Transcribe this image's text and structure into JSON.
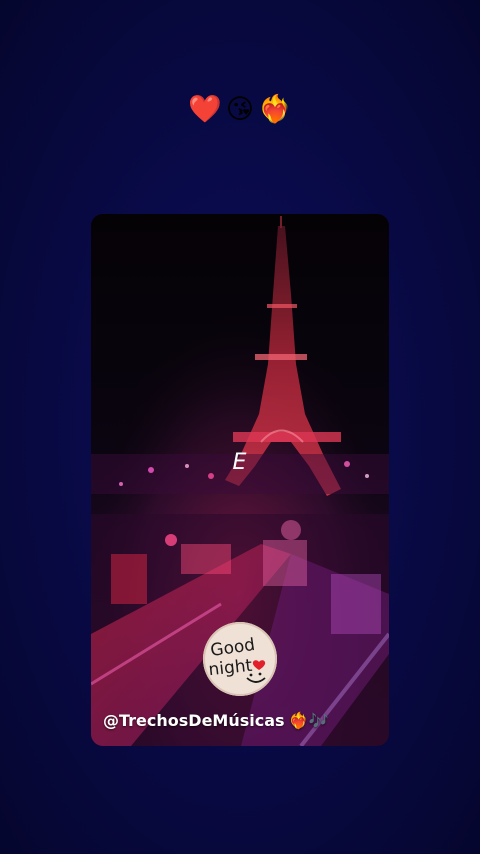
{
  "top_reactions": {
    "emojis": [
      "❤️",
      "😘",
      "❤️‍🔥"
    ],
    "icon_names": [
      "red-heart-icon",
      "face-blowing-kiss-icon",
      "heart-on-fire-icon"
    ]
  },
  "video": {
    "caption_letter": "E",
    "sticker": {
      "text_line1": "Good",
      "text_line2": "night",
      "icon": "smiley-heart-icon"
    },
    "watermark_handle": "@TrechosDeMúsicas",
    "watermark_emojis": "❤️‍🔥🎶"
  },
  "colors": {
    "background": "#090a48",
    "tower_red": "#d23048",
    "sticker_bg": "#efe1d6"
  }
}
